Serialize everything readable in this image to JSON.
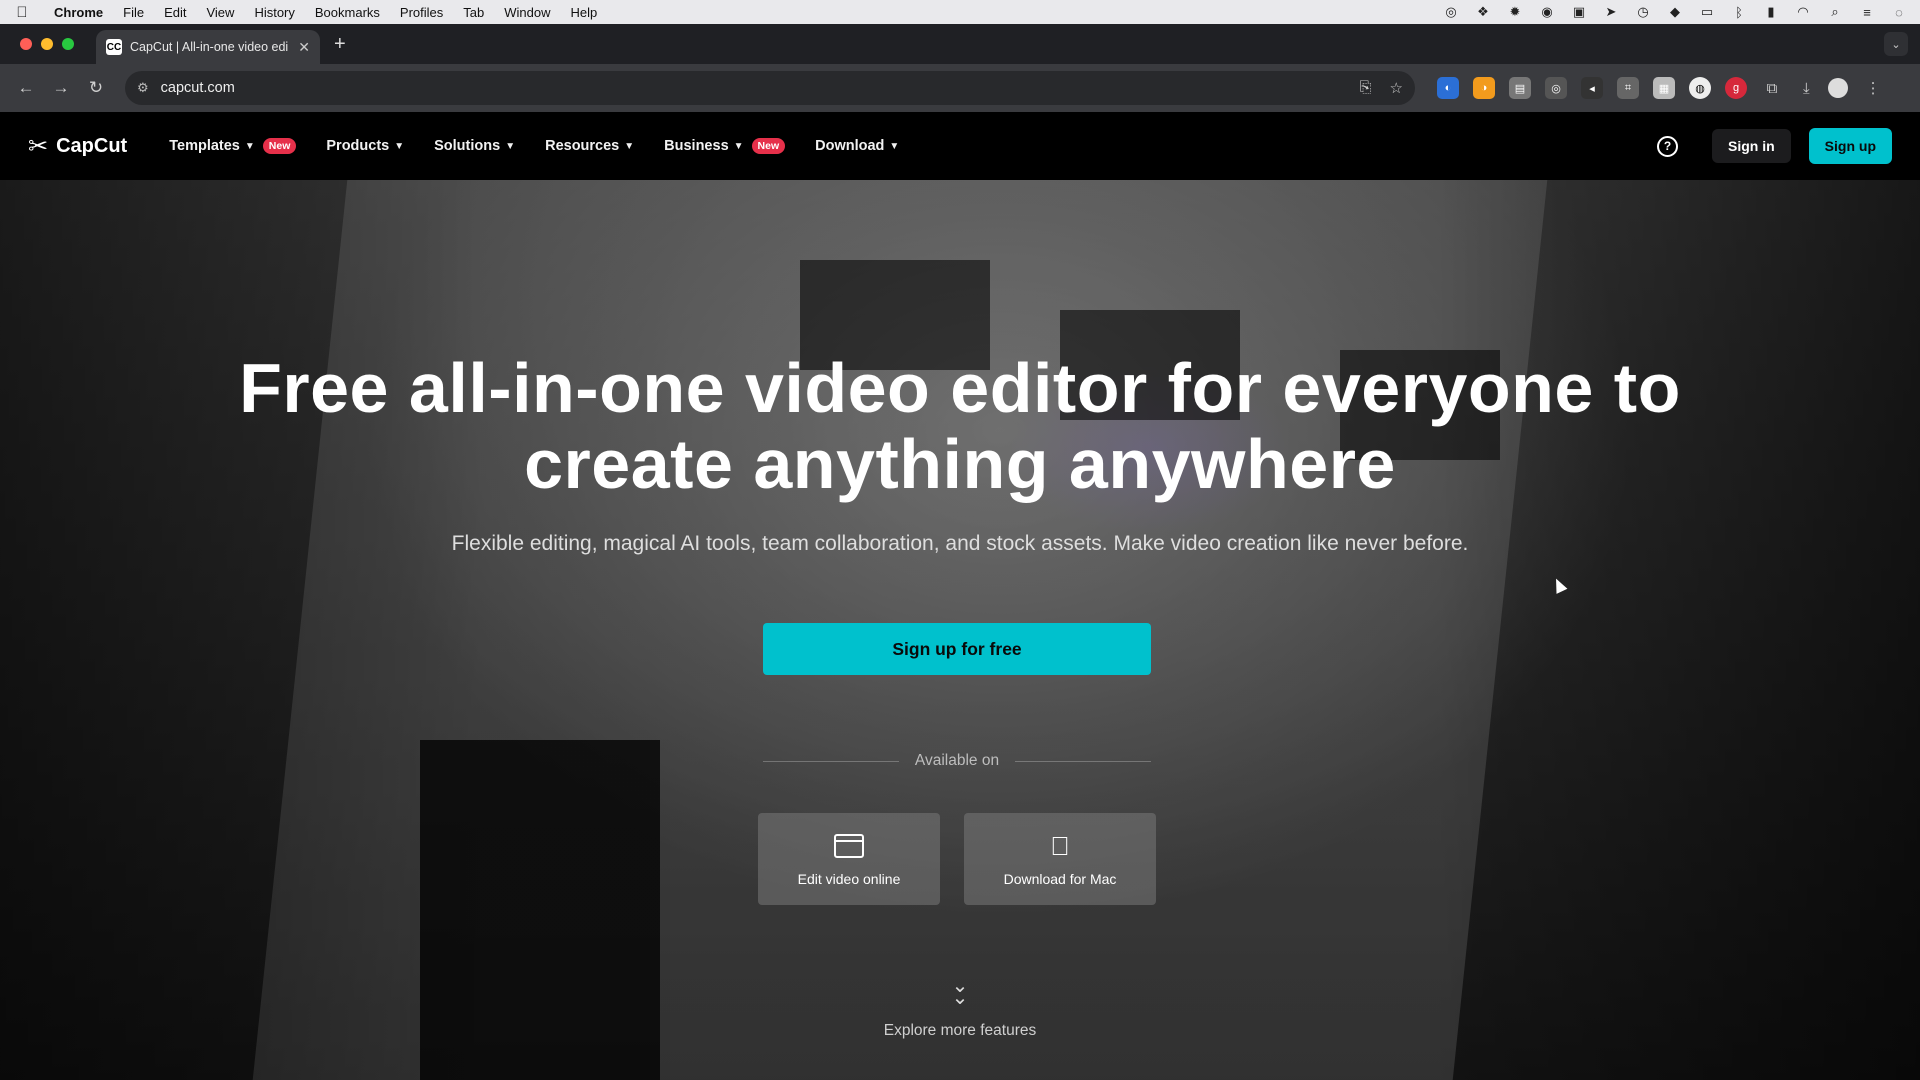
{
  "menubar": {
    "app_name": "Chrome",
    "items": [
      "File",
      "Edit",
      "View",
      "History",
      "Bookmarks",
      "Profiles",
      "Tab",
      "Window",
      "Help"
    ]
  },
  "browser": {
    "tab_title": "CapCut | All-in-one video edi",
    "tab_favicon": "CC",
    "url": "capcut.com"
  },
  "header": {
    "logo_text": "CapCut",
    "nav": [
      {
        "label": "Templates",
        "badge": "New"
      },
      {
        "label": "Products",
        "badge": ""
      },
      {
        "label": "Solutions",
        "badge": ""
      },
      {
        "label": "Resources",
        "badge": ""
      },
      {
        "label": "Business",
        "badge": "New"
      },
      {
        "label": "Download",
        "badge": ""
      }
    ],
    "sign_in": "Sign in",
    "sign_up": "Sign up"
  },
  "hero": {
    "headline_line1": "Free all-in-one video editor for everyone to",
    "headline_line2": "create anything anywhere",
    "subline": "Flexible editing, magical AI tools, team collaboration, and stock assets. Make video creation like never before.",
    "cta": "Sign up for free",
    "available_on": "Available on",
    "platforms": [
      {
        "label": "Edit video online",
        "icon": "browser-window-icon"
      },
      {
        "label": "Download for Mac",
        "icon": "apple-icon"
      }
    ],
    "explore": "Explore more features"
  },
  "colors": {
    "accent": "#00c1cd",
    "badge": "#e6304a",
    "header_bg": "#000000"
  }
}
